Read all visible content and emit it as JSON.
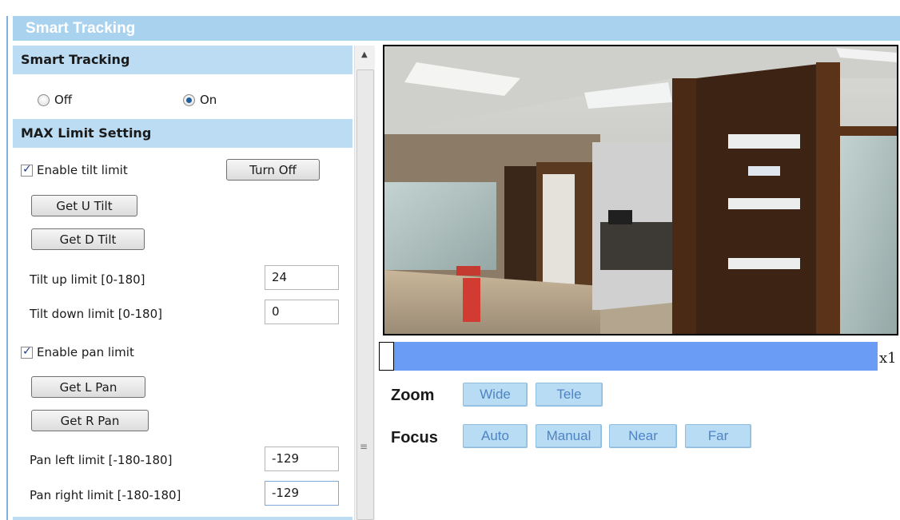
{
  "window": {
    "title": "Smart Tracking"
  },
  "smart_tracking": {
    "heading": "Smart Tracking",
    "options": [
      {
        "label": "Off",
        "selected": false
      },
      {
        "label": "On",
        "selected": true
      }
    ]
  },
  "max_limit": {
    "heading": "MAX Limit Setting",
    "tilt": {
      "enable_label": "Enable tilt limit",
      "enabled": true,
      "turn_off_label": "Turn Off",
      "get_up_label": "Get U Tilt",
      "get_down_label": "Get D Tilt",
      "up_label": "Tilt up limit [0-180]",
      "up_value": "24",
      "down_label": "Tilt down limit [0-180]",
      "down_value": "0"
    },
    "pan": {
      "enable_label": "Enable pan limit",
      "enabled": true,
      "get_left_label": "Get L Pan",
      "get_right_label": "Get R Pan",
      "left_label": "Pan left limit [-180-180]",
      "left_value": "-129",
      "right_label": "Pan right limit [-180-180]",
      "right_value": "-129"
    }
  },
  "zoom_slider": {
    "level": 0.0,
    "readout": "x1"
  },
  "controls": {
    "zoom": {
      "label": "Zoom",
      "wide": "Wide",
      "tele": "Tele"
    },
    "focus": {
      "label": "Focus",
      "auto": "Auto",
      "manual": "Manual",
      "near": "Near",
      "far": "Far"
    }
  },
  "colors": {
    "title_bar": "#a9d2ef",
    "section_header": "#bcdcf3",
    "zoom_track": "#6a9cf5",
    "control_button": "#b9dcf5"
  }
}
